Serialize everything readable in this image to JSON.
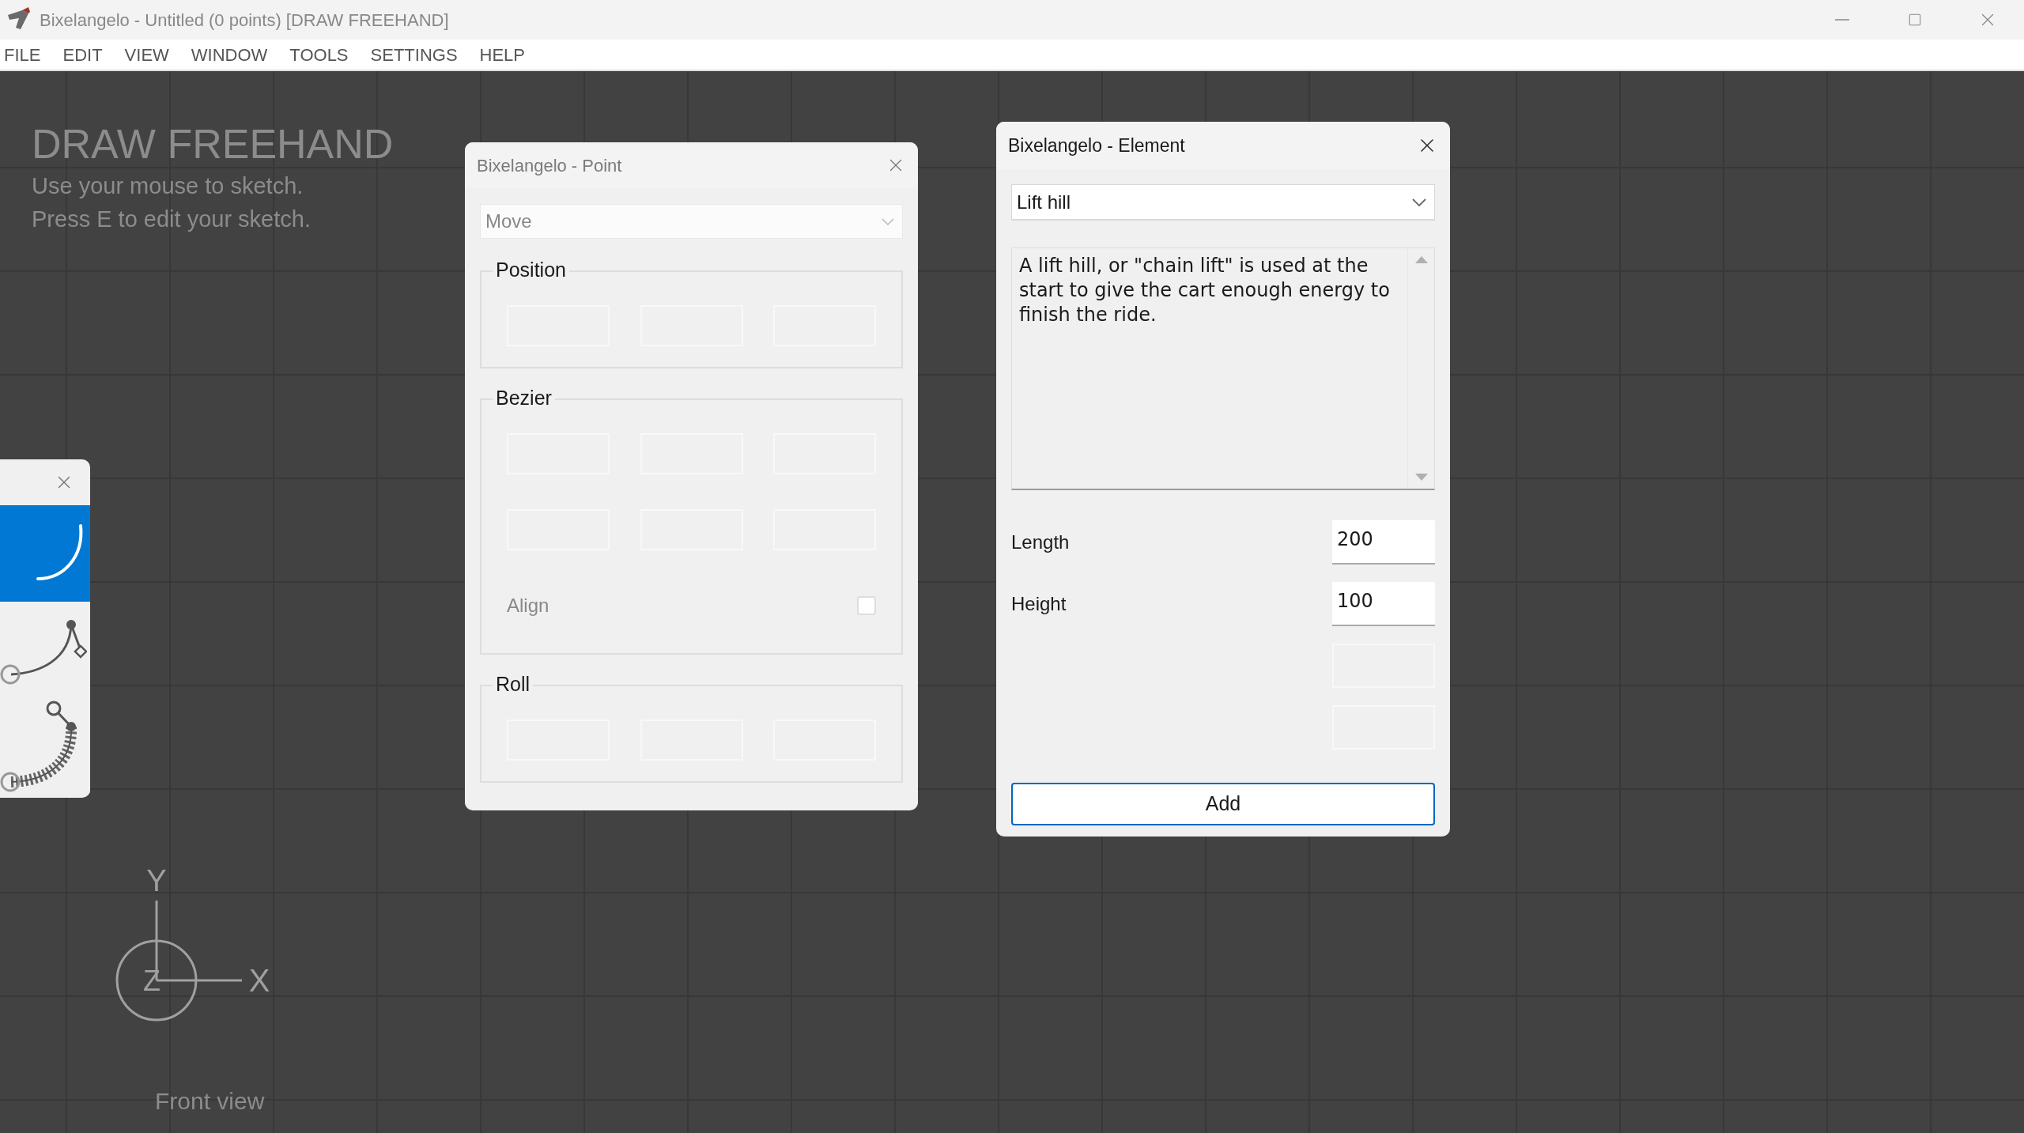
{
  "window": {
    "title": "Bixelangelo - Untitled (0 points) [DRAW FREEHAND]"
  },
  "menu": [
    "FILE",
    "EDIT",
    "VIEW",
    "WINDOW",
    "TOOLS",
    "SETTINGS",
    "HELP"
  ],
  "canvas": {
    "heading": "DRAW FREEHAND",
    "hints": [
      "Use your mouse to sketch.",
      "Press E to edit your sketch."
    ],
    "axes": {
      "x": "X",
      "y": "Y",
      "z": "Z"
    },
    "view_label": "Front view"
  },
  "tool_palette": {
    "tools": [
      {
        "kind": "freehand",
        "selected": true
      },
      {
        "kind": "bezier",
        "selected": false
      },
      {
        "kind": "track",
        "selected": false
      }
    ]
  },
  "point_dialog": {
    "title": "Bixelangelo - Point",
    "mode": "Move",
    "groups": [
      {
        "label": "Position",
        "kind": "vector"
      },
      {
        "label": "Bezier",
        "kind": "bezier",
        "checkbox": {
          "label": "Align",
          "checked": false
        }
      },
      {
        "label": "Roll",
        "kind": "vector"
      }
    ]
  },
  "element_dialog": {
    "title": "Bixelangelo - Element",
    "element": "Lift hill",
    "description": "A lift hill, or \"chain lift\" is used at the start to give the cart enough energy to finish the ride.",
    "params": [
      {
        "label": "Length",
        "value": "200",
        "disabled": false
      },
      {
        "label": "Height",
        "value": "100",
        "disabled": false
      },
      {
        "disabled": true
      },
      {
        "disabled": true
      }
    ],
    "button": "Add"
  }
}
